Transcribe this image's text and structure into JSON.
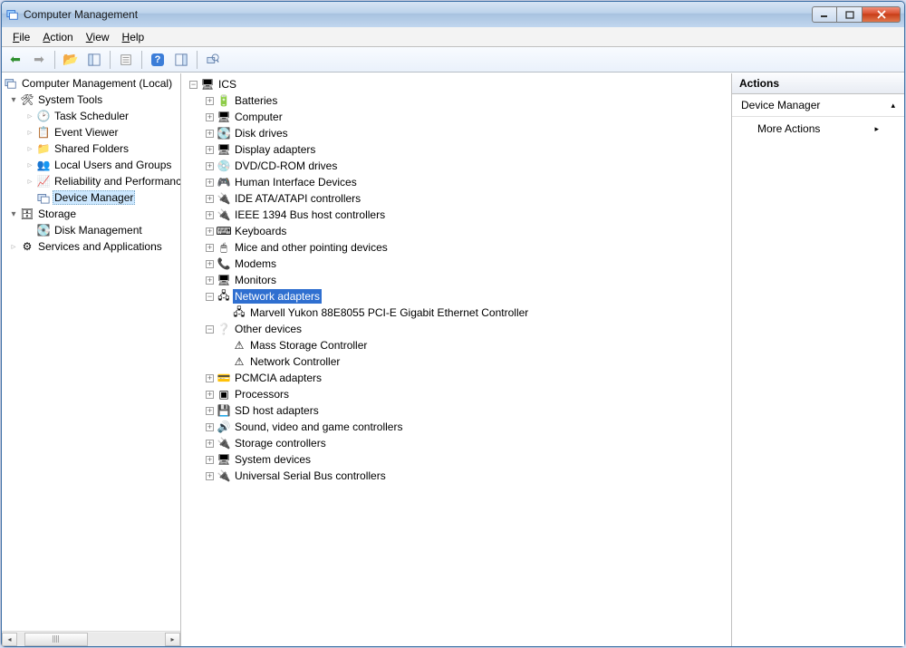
{
  "window": {
    "title": "Computer Management"
  },
  "menu": {
    "file": "File",
    "action": "Action",
    "view": "View",
    "help": "Help"
  },
  "left_tree": {
    "root": "Computer Management (Local)",
    "system_tools": "System Tools",
    "task_scheduler": "Task Scheduler",
    "event_viewer": "Event Viewer",
    "shared_folders": "Shared Folders",
    "local_users": "Local Users and Groups",
    "reliability": "Reliability and Performance",
    "device_manager": "Device Manager",
    "storage": "Storage",
    "disk_management": "Disk Management",
    "services_apps": "Services and Applications"
  },
  "mid_tree": {
    "root": "ICS",
    "batteries": "Batteries",
    "computer": "Computer",
    "disk_drives": "Disk drives",
    "display_adapters": "Display adapters",
    "dvd": "DVD/CD-ROM drives",
    "hid": "Human Interface Devices",
    "ide": "IDE ATA/ATAPI controllers",
    "ieee1394": "IEEE 1394 Bus host controllers",
    "keyboards": "Keyboards",
    "mice": "Mice and other pointing devices",
    "modems": "Modems",
    "monitors": "Monitors",
    "network_adapters": "Network adapters",
    "marvell": "Marvell Yukon 88E8055 PCI-E Gigabit Ethernet Controller",
    "other_devices": "Other devices",
    "mass_storage": "Mass Storage Controller",
    "network_controller": "Network Controller",
    "pcmcia": "PCMCIA adapters",
    "processors": "Processors",
    "sd_host": "SD host adapters",
    "sound": "Sound, video and game controllers",
    "storage_ctrl": "Storage controllers",
    "system_devices": "System devices",
    "usb": "Universal Serial Bus controllers"
  },
  "actions": {
    "header": "Actions",
    "section": "Device Manager",
    "more": "More Actions"
  }
}
